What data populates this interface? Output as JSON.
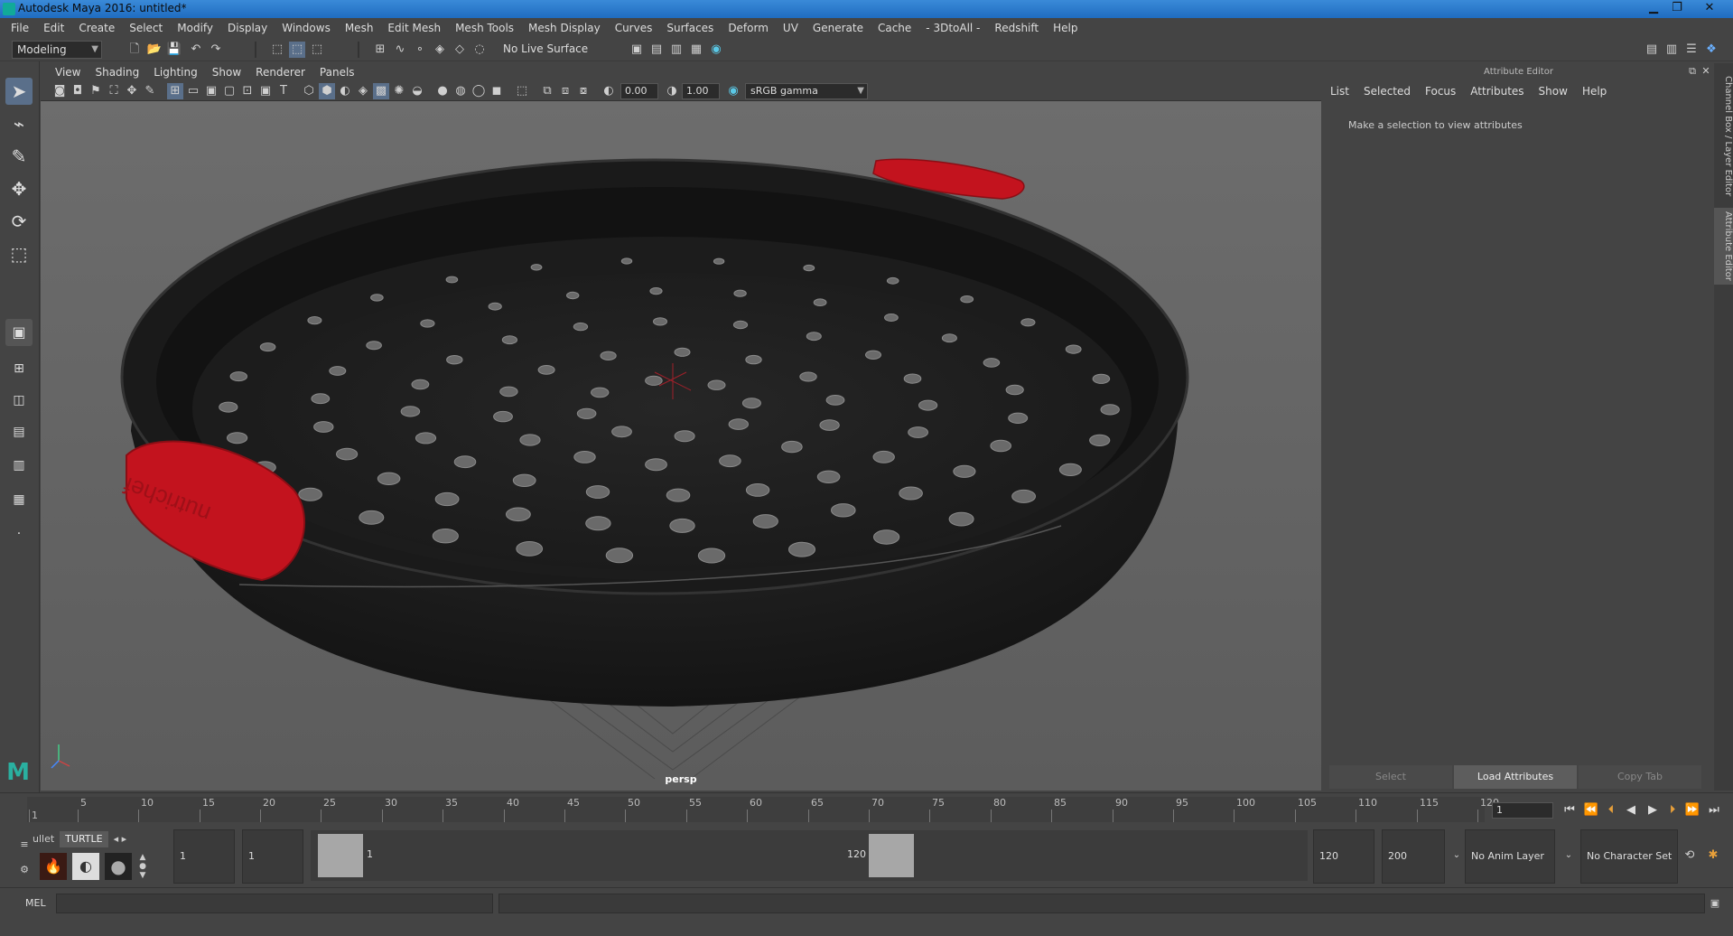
{
  "window": {
    "title": "Autodesk Maya 2016: untitled*",
    "minimize_icon": "minimize-icon",
    "restore_icon": "restore-icon",
    "close_icon": "close-icon"
  },
  "menubar": [
    "File",
    "Edit",
    "Create",
    "Select",
    "Modify",
    "Display",
    "Windows",
    "Mesh",
    "Edit Mesh",
    "Mesh Tools",
    "Mesh Display",
    "Curves",
    "Surfaces",
    "Deform",
    "UV",
    "Generate",
    "Cache",
    "- 3DtoAll -",
    "Redshift",
    "Help"
  ],
  "statusline": {
    "menuset": "Modeling",
    "live_surface": "No Live Surface"
  },
  "viewport": {
    "menu": [
      "View",
      "Shading",
      "Lighting",
      "Show",
      "Renderer",
      "Panels"
    ],
    "exposure": "0.00",
    "gamma": "1.00",
    "colorspace": "sRGB gamma",
    "camera_label": "persp",
    "model_text": "nutrichef",
    "colors": {
      "pan": "#1c1c1c",
      "handle": "#c3131e",
      "background": "#676767"
    }
  },
  "attribute_editor": {
    "title": "Attribute Editor",
    "menu": [
      "List",
      "Selected",
      "Focus",
      "Attributes",
      "Show",
      "Help"
    ],
    "message": "Make a selection to view attributes",
    "buttons": [
      "Select",
      "Load Attributes",
      "Copy Tab"
    ]
  },
  "side_tabs": [
    "Channel Box / Layer Editor",
    "Attribute Editor"
  ],
  "timeline": {
    "ticks": [
      1,
      5,
      10,
      15,
      20,
      25,
      30,
      35,
      40,
      45,
      50,
      55,
      60,
      65,
      70,
      75,
      80,
      85,
      90,
      95,
      100,
      105,
      110,
      115,
      120
    ],
    "start": 1,
    "end": 120,
    "current_frame": "1"
  },
  "range": {
    "start_field": "1",
    "start_range": "1",
    "slider_start_label": "1",
    "slider_end_label": "120",
    "end_range": "120",
    "end_field": "200",
    "anim_layer": "No Anim Layer",
    "character_set": "No Character Set"
  },
  "shelf": {
    "tabs": [
      "ullet",
      "TURTLE"
    ]
  },
  "mel": {
    "label": "MEL"
  }
}
